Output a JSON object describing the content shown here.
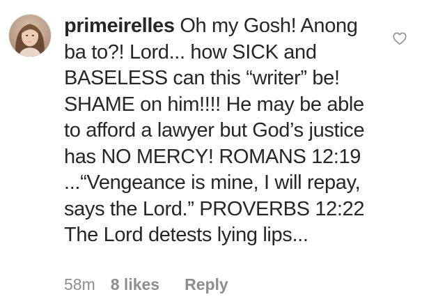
{
  "comment": {
    "username": "primeirelles",
    "text": "Oh my Gosh! Anong ba to?! Lord... how SICK and BASELESS can this “writer” be! SHAME on him!!!! He may be able to afford a lawyer but God’s justice has NO MERCY! ROMANS 12:19 ...“Vengeance is mine, I will repay, says the Lord.” PROVERBS 12:22 The Lord detests lying lips...",
    "time": "58m",
    "likes": "8 likes",
    "reply_label": "Reply"
  },
  "icons": {
    "avatar": "user-avatar-photo",
    "like": "heart-outline-icon"
  },
  "colors": {
    "text": "#262626",
    "meta": "#8e8e8e",
    "background": "#ffffff",
    "icon": "#8e8e8e"
  }
}
